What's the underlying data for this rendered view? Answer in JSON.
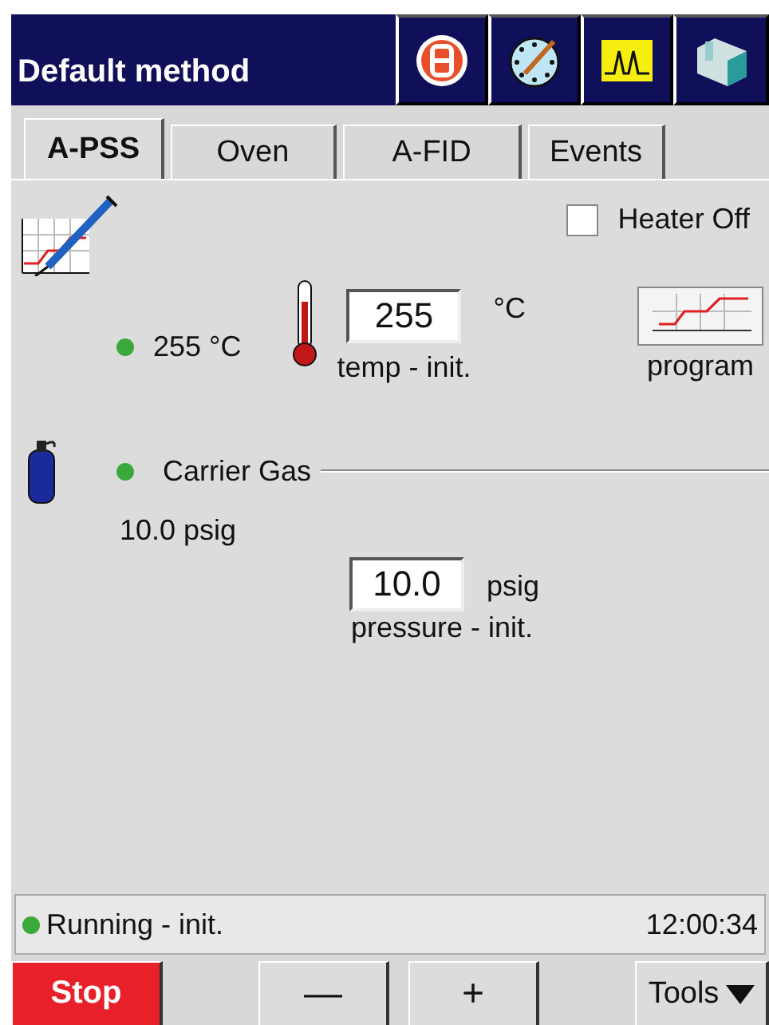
{
  "window": {
    "title": "Default method"
  },
  "tabs": [
    {
      "label": "A-PSS",
      "selected": true
    },
    {
      "label": "Oven",
      "selected": false
    },
    {
      "label": "A-FID",
      "selected": false
    },
    {
      "label": "Events",
      "selected": false
    }
  ],
  "heater_off": {
    "label": "Heater Off",
    "checked": false
  },
  "temperature": {
    "color": "#3aa83a",
    "reading": "255 °C",
    "setpoint": "255",
    "unit": "°C",
    "caption": "temp - init.",
    "program_button": "program"
  },
  "carrier_gas": {
    "color": "#3aa83a",
    "label": "Carrier Gas",
    "reading": "10.0 psig",
    "setpoint": "10.0",
    "unit": "psig",
    "caption": "pressure - init."
  },
  "status_bar": {
    "color": "#3aa83a",
    "text": "Running - init.",
    "time": "12:00:34"
  },
  "buttons": [
    {
      "label": "Stop",
      "kind": "stop"
    },
    {
      "label": "—",
      "kind": "plain"
    },
    {
      "label": "+",
      "kind": "plain"
    },
    {
      "label": "Tools",
      "kind": "menu"
    }
  ]
}
